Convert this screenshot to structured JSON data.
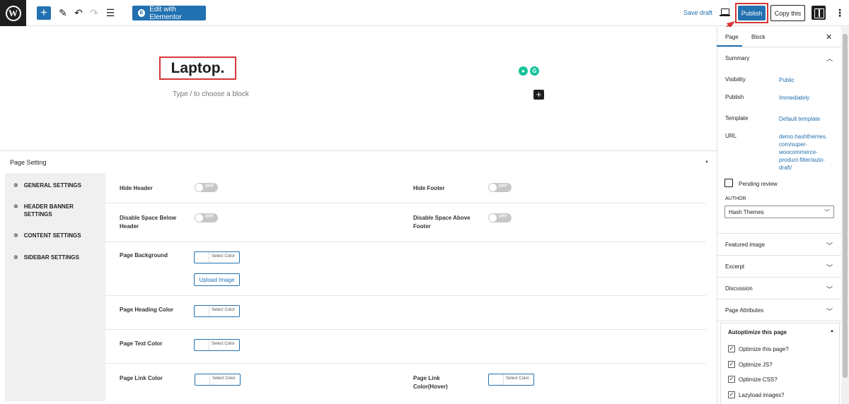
{
  "toolbar": {
    "edit_elementor_label": "Edit with Elementor",
    "save_draft_label": "Save draft",
    "publish_label": "Publish",
    "copy_label": "Copy this"
  },
  "editor": {
    "title": "Laptop.",
    "placeholder": "Type / to choose a block"
  },
  "page_setting": {
    "title": "Page Setting",
    "nav": [
      {
        "label": "GENERAL SETTINGS"
      },
      {
        "label": "HEADER BANNER SETTINGS"
      },
      {
        "label": "CONTENT SETTINGS"
      },
      {
        "label": "SIDEBAR SETTINGS"
      }
    ],
    "fields": {
      "hide_header": "Hide Header",
      "hide_footer": "Hide Footer",
      "disable_below": "Disable Space Below Header",
      "disable_above": "Disable Space Above Footer",
      "page_background": "Page Background",
      "page_heading_color": "Page Heading Color",
      "page_text_color": "Page Text Color",
      "page_link_color": "Page Link Color",
      "page_link_hover": "Page Link Color(Hover)"
    },
    "toggle_off": "OFF",
    "select_color": "Select Color",
    "upload_image": "Upload Image"
  },
  "sidebar": {
    "tabs": [
      "Page",
      "Block"
    ],
    "summary_title": "Summary",
    "visibility_label": "Visibility",
    "visibility_value": "Public",
    "publish_label": "Publish",
    "publish_value": "Immediately",
    "template_label": "Template",
    "template_value": "Default template",
    "url_label": "URL",
    "url_value": "demo.hashthemes.com/super-woocommerce-product-filter/auto-draft/",
    "pending_review": "Pending review",
    "author_label": "AUTHOR",
    "author_value": "Hash Themes",
    "panels": [
      "Featured image",
      "Excerpt",
      "Discussion",
      "Page Attributes"
    ],
    "autoptimize_title": "Autoptimize this page",
    "autoptimize_options": [
      "Optimize this page?",
      "Optimize JS?",
      "Optimize CSS?",
      "Lazyload images?"
    ]
  },
  "colors": {
    "accent": "#2271b1",
    "highlight": "#d63638"
  }
}
